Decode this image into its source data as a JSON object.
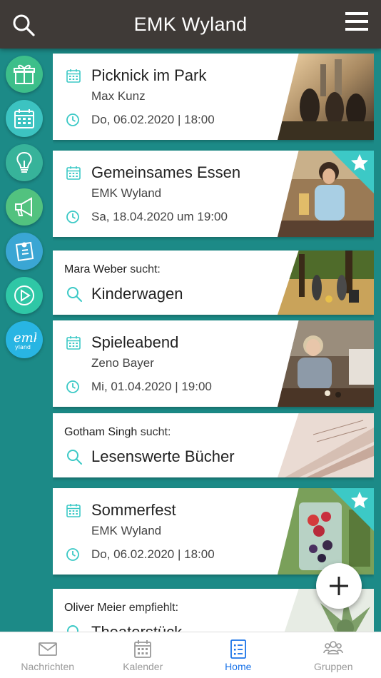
{
  "header": {
    "title": "EMK Wyland"
  },
  "rail": [
    {
      "name": "gift-icon",
      "color": "#3dbf8a"
    },
    {
      "name": "calendar-icon",
      "color": "#3cc3c1"
    },
    {
      "name": "lightbulb-icon",
      "color": "#37b39a"
    },
    {
      "name": "megaphone-icon",
      "color": "#52c27f"
    },
    {
      "name": "pinned-note-icon",
      "color": "#3aa6d4"
    },
    {
      "name": "play-icon",
      "color": "#2fc7a6"
    },
    {
      "name": "emk-logo",
      "color": "#28b5e3"
    }
  ],
  "cards": [
    {
      "type": "event",
      "title": "Picknick im Park",
      "sub": "Max Kunz",
      "when": "Do, 06.02.2020 | 18:00",
      "starred": false
    },
    {
      "type": "event",
      "title": "Gemeinsames Essen",
      "sub": "EMK Wyland",
      "when": "Sa, 18.04.2020 um 19:00",
      "starred": true
    },
    {
      "type": "search",
      "person": "Mara Weber",
      "verb": "sucht:",
      "title": "Kinderwagen"
    },
    {
      "type": "event",
      "title": "Spieleabend",
      "sub": "Zeno Bayer",
      "when": "Mi, 01.04.2020 | 19:00",
      "starred": false
    },
    {
      "type": "search",
      "person": "Gotham Singh",
      "verb": "sucht:",
      "title": "Lesenswerte Bücher"
    },
    {
      "type": "event",
      "title": "Sommerfest",
      "sub": "EMK Wyland",
      "when": "Do, 06.02.2020 | 18:00",
      "starred": true
    },
    {
      "type": "recommend",
      "person": "Oliver Meier",
      "verb": "empfiehlt:",
      "title": "Theaterstück"
    }
  ],
  "tabs": [
    {
      "label": "Nachrichten",
      "icon": "mail-icon",
      "active": false
    },
    {
      "label": "Kalender",
      "icon": "calendar-icon",
      "active": false
    },
    {
      "label": "Home",
      "icon": "list-icon",
      "active": true
    },
    {
      "label": "Gruppen",
      "icon": "group-icon",
      "active": false
    }
  ],
  "colors": {
    "accent": "#3cc9c6",
    "topbar": "#3f3a37",
    "background": "#1c8a87",
    "active_tab": "#1a73e8"
  }
}
